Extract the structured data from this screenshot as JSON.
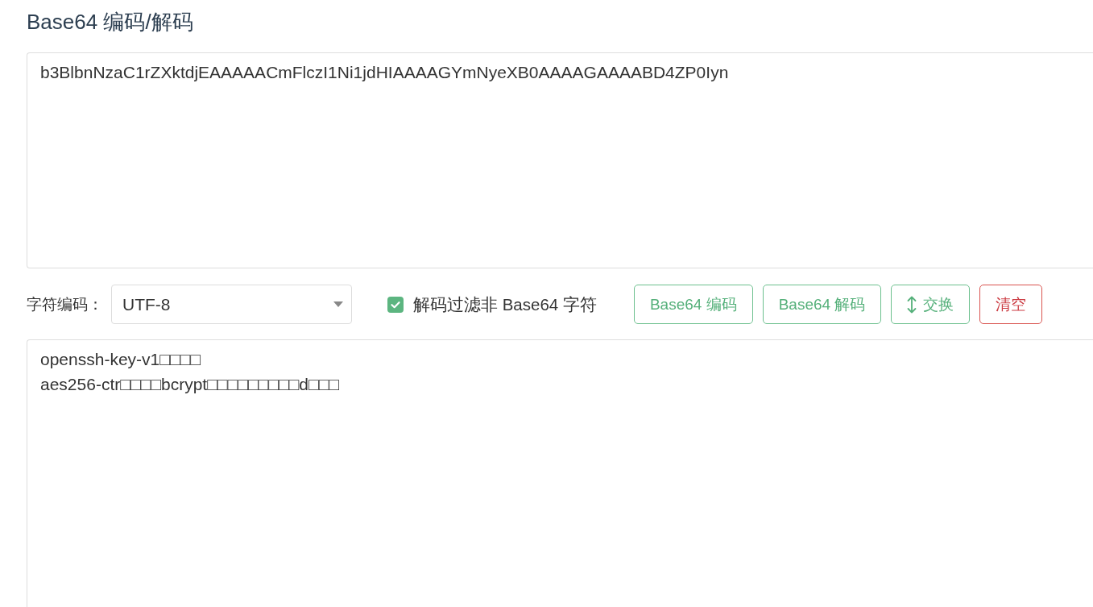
{
  "page": {
    "title": "Base64 编码/解码"
  },
  "input": {
    "value": "b3BlbnNzaC1rZXktdjEAAAAACmFlczI1Ni1jdHIAAAAGYmNyeXB0AAAAGAAAABD4ZP0Iyn"
  },
  "options": {
    "charset_label": "字符编码：",
    "charset": {
      "value": "UTF-8"
    },
    "filter": {
      "label": "解码过滤非 Base64 字符",
      "checked": true
    }
  },
  "buttons": [
    {
      "label": "Base64 编码",
      "kind": "action"
    },
    {
      "label": "Base64 解码",
      "kind": "action"
    },
    {
      "label": "交换",
      "kind": "swap"
    },
    {
      "label": "清空",
      "kind": "danger"
    }
  ],
  "output": {
    "value": "openssh-key-v1□□□□\naes256-ctr□□□□bcrypt□□□□□□□□□d□□□"
  }
}
